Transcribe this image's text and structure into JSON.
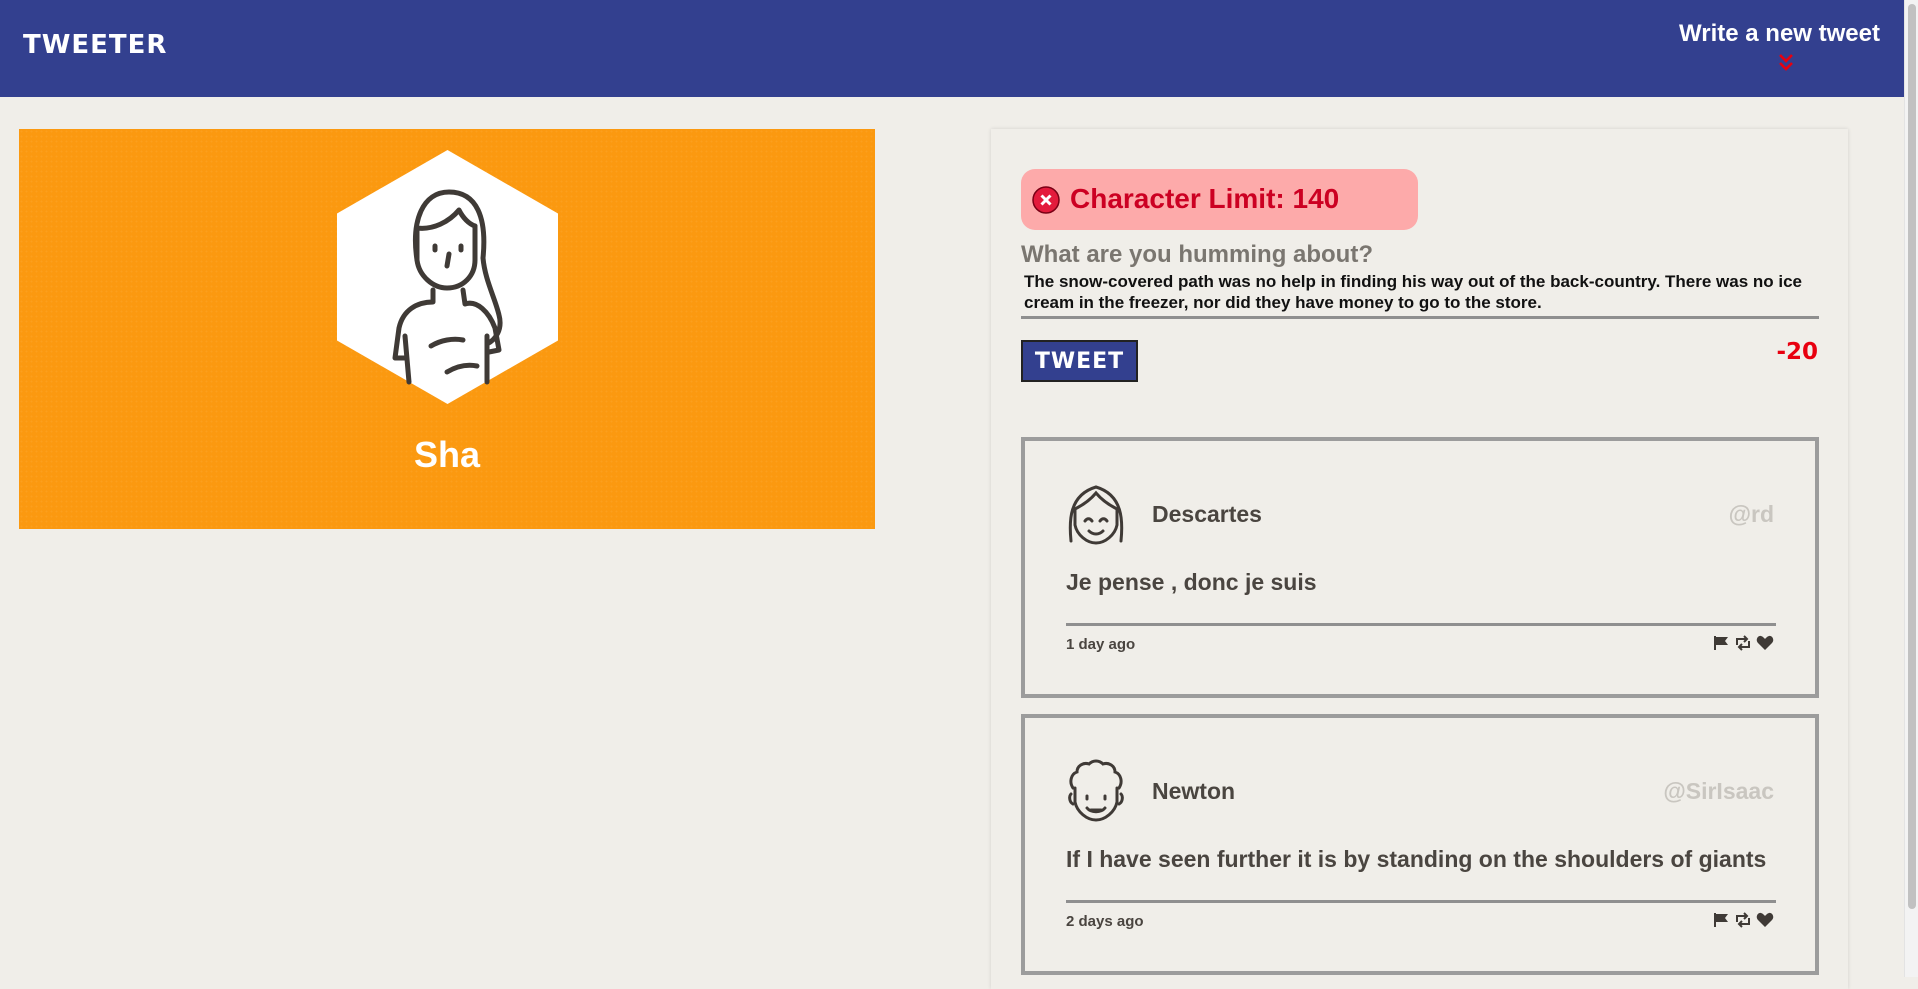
{
  "nav": {
    "brand": "TWEETER",
    "compose_label": "Write a new tweet",
    "compose_icon": "double-chevron-down-icon"
  },
  "profile": {
    "name": "Sha",
    "avatar_icon": "woman-avatar-icon",
    "background_color": "#fb9910"
  },
  "composer": {
    "error": {
      "icon": "error-x-icon",
      "text": "Character Limit: 140"
    },
    "prompt": "What are you humming about?",
    "value": "The snow-covered path was no help in finding his way out of the back-country. There was no ice cream in the freezer, nor did they have money to go to the store.",
    "button_label": "TWEET",
    "counter": "-20"
  },
  "tweets": [
    {
      "name": "Descartes",
      "handle": "@rd",
      "avatar_icon": "bob-hair-face-icon",
      "content": "Je pense , donc je suis",
      "time": "1 day ago"
    },
    {
      "name": "Newton",
      "handle": "@SirIsaac",
      "avatar_icon": "curly-hair-face-icon",
      "content": "If I have seen further it is by standing on the shoulders of giants",
      "time": "2 days ago"
    }
  ],
  "colors": {
    "nav": "#33408f",
    "accent_red": "#e8000f",
    "error_bg": "#fdaaaa"
  }
}
